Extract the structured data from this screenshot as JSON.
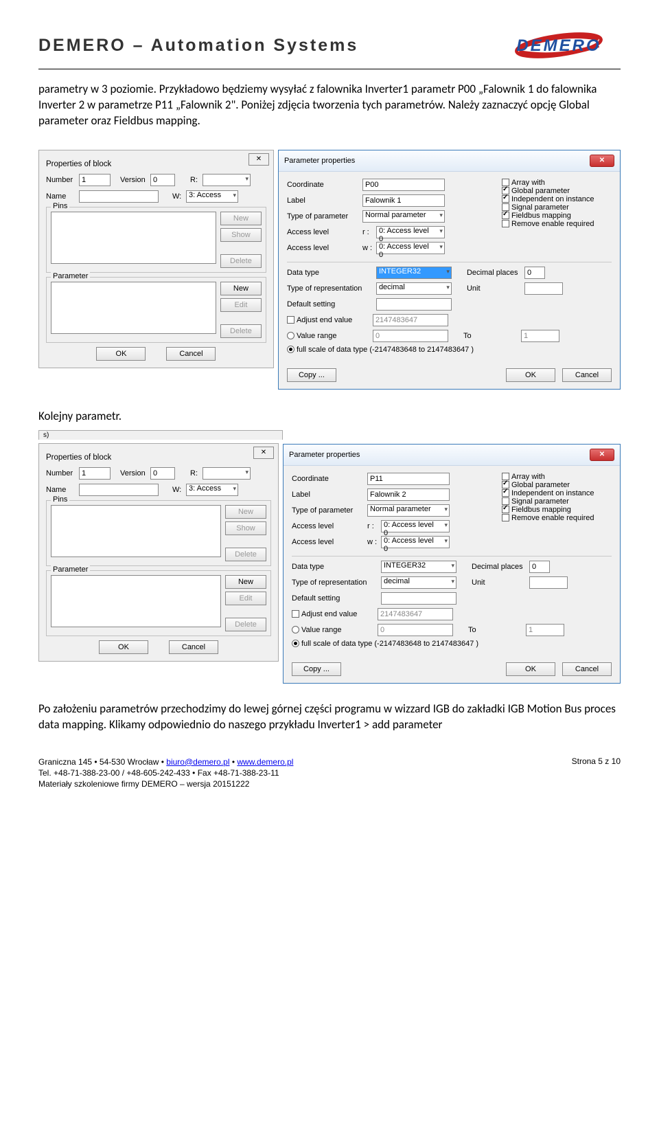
{
  "header": {
    "title": "DEMERO – Automation Systems",
    "logo_text": "DEMERO"
  },
  "para1": "parametry w 3 poziomie. Przykładowo będziemy  wysyłać z falownika Inverter1 parametr P00 „Falownik 1 do falownika Inverter 2 w parametrze P11 „Falownik 2\". Poniżej zdjęcia tworzenia tych parametrów. Należy zaznaczyć opcję Global parameter oraz Fieldbus mapping.",
  "para2": "Kolejny parametr.",
  "para3": "Po założeniu parametrów przechodzimy do lewej górnej części programu w wizzard IGB do zakładki IGB Motion Bus proces data mapping. Klikamy odpowiednio do naszego przykładu Inverter1 > add parameter",
  "block": {
    "title": "Properties of block",
    "number_lbl": "Number",
    "number": "1",
    "version_lbl": "Version",
    "version": "0",
    "r_lbl": "R:",
    "name_lbl": "Name",
    "w_lbl": "W:",
    "w_val": "3: Access",
    "pins_lbl": "Pins",
    "param_lbl": "Parameter",
    "new": "New",
    "show": "Show",
    "edit": "Edit",
    "delete": "Delete",
    "ok": "OK",
    "cancel": "Cancel"
  },
  "pp1": {
    "title": "Parameter properties",
    "coord_lbl": "Coordinate",
    "coord": "P00",
    "label_lbl": "Label",
    "label": "Falownik 1",
    "type_lbl": "Type of parameter",
    "type": "Normal parameter",
    "acc_r_lbl": "Access level",
    "acc_r_pre": "r :",
    "acc_r": "0: Access level 0",
    "acc_w_lbl": "Access level",
    "acc_w_pre": "w :",
    "acc_w": "0: Access level 0",
    "array_with": "Array with",
    "global_param": "Global parameter",
    "indep": "Independent on instance",
    "signal_param": "Signal parameter",
    "fieldbus": "Fieldbus mapping",
    "remove_en": "Remove enable required",
    "data_type_lbl": "Data type",
    "data_type": "INTEGER32",
    "repr_lbl": "Type of representation",
    "repr": "decimal",
    "default_lbl": "Default setting",
    "adjust_end": "Adjust end value",
    "adjust_val": "2147483647",
    "value_range": "Value range",
    "value_range_from": "0",
    "to_lbl": "To",
    "to_val": "1",
    "full_scale": "full scale of data type (-2147483648  to 2147483647 )",
    "decimal_lbl": "Decimal places",
    "decimal": "0",
    "unit_lbl": "Unit",
    "copy": "Copy ...",
    "ok": "OK",
    "cancel": "Cancel"
  },
  "pp2": {
    "coord": "P11",
    "label": "Falownik 2"
  },
  "footer": {
    "addr": "Graniczna 145 • 54-530 Wrocław • ",
    "email": "biuro@demero.pl",
    "sep1": " • ",
    "url": "www.demero.pl",
    "tel": "Tel. +48-71-388-23-00 / +48-605-242-433 • Fax +48-71-388-23-11",
    "mat": "Materiały szkoleniowe firmy DEMERO – wersja 20151222",
    "page": "Strona 5 z 10"
  }
}
